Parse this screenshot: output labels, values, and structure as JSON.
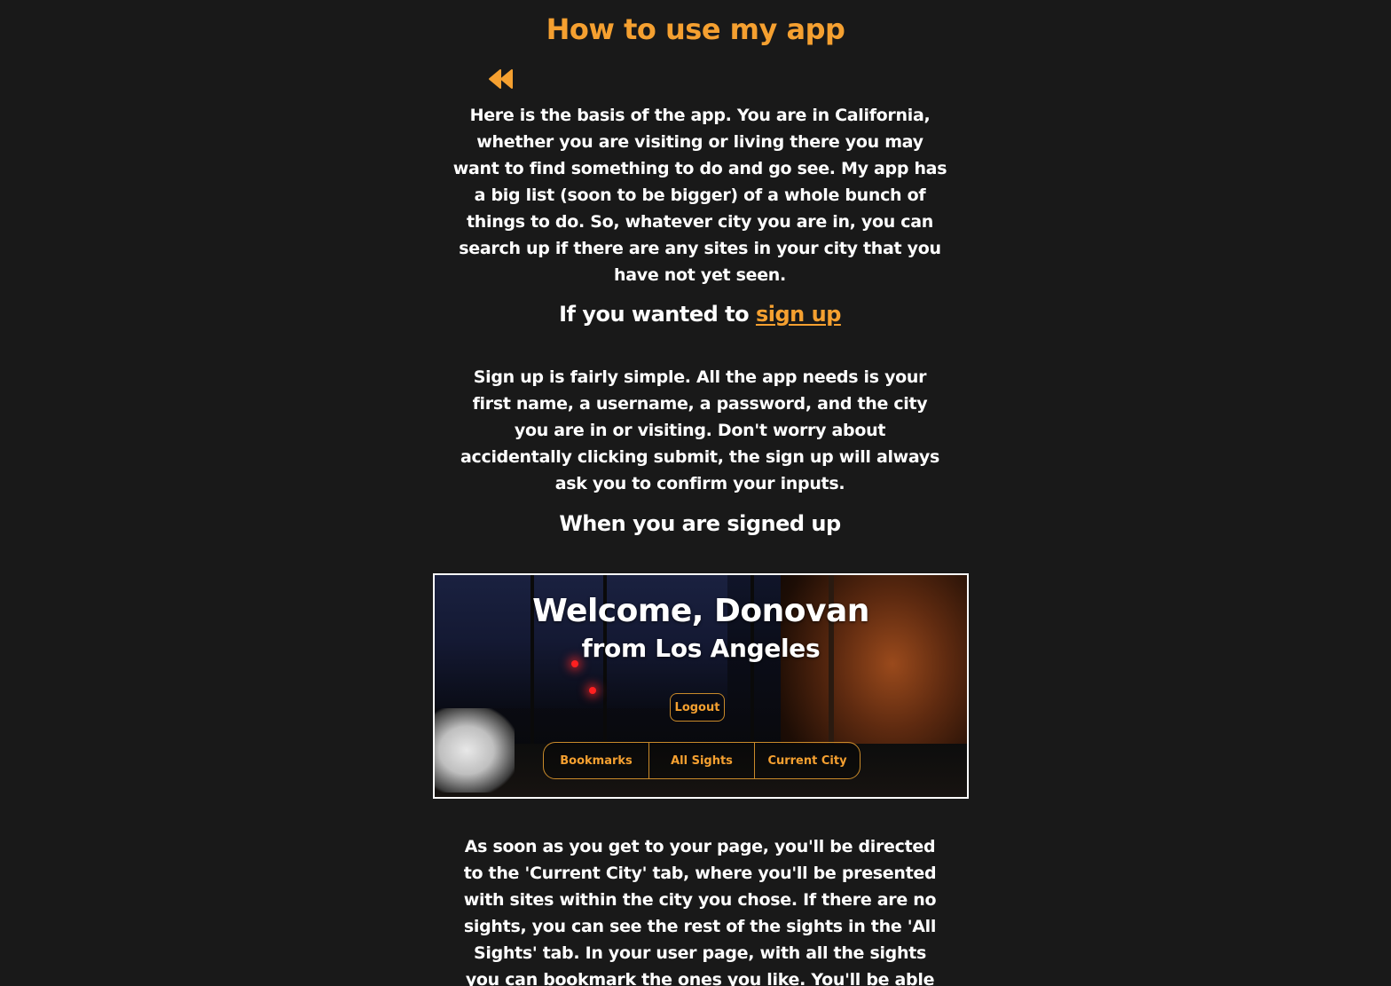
{
  "page": {
    "title": "How to use my app",
    "back_icon": "rewind-double-chevron-left-icon",
    "accent_color": "#f5a030",
    "background_color": "#191919"
  },
  "intro": {
    "text": "Here is the basis of the app. You are in California, whether you are visiting or living there you may want to find something to do and go see. My app has a big list (soon to be bigger) of a whole bunch of things to do. So, whatever city you are in, you can search up if there are any sites in your city that you have not yet seen."
  },
  "signup_section": {
    "heading_prefix": "If you wanted to ",
    "heading_link": "sign up",
    "text": "Sign up is fairly simple. All the app needs is your first name, a username, a password, and the city you are in or visiting. Don't worry about accidentally clicking submit, the sign up will always ask you to confirm your inputs."
  },
  "signed_up_section": {
    "heading": "When you are signed up",
    "screenshot": {
      "welcome": "Welcome, Donovan",
      "from": "from Los Angeles",
      "logout_label": "Logout",
      "tabs": [
        "Bookmarks",
        "All Sights",
        "Current City"
      ]
    },
    "text": "As soon as you get to your page, you'll be directed to the 'Current City' tab, where you'll be presented with sites within the city you chose. If there are no sights, you can see the rest of the sights in the 'All Sights' tab. In your user page, with all the sights you can bookmark the ones you like. You'll be able to see your bookmarked sights in"
  }
}
